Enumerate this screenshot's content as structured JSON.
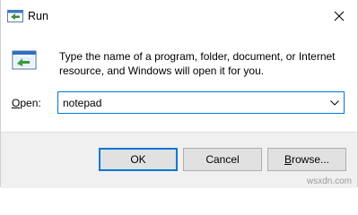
{
  "window": {
    "title": "Run",
    "close_icon": "close-icon",
    "title_icon": "run-icon"
  },
  "dialog": {
    "description": "Type the name of a program, folder, document, or Internet resource, and Windows will open it for you.",
    "open_label_mnemonic": "O",
    "open_label_rest": "pen:",
    "open_value": "notepad"
  },
  "buttons": {
    "ok": "OK",
    "cancel": "Cancel",
    "browse_mnemonic": "B",
    "browse_rest": "rowse..."
  },
  "watermark": "wsxdn.com",
  "colors": {
    "accent": "#0078d7",
    "footer_bg": "#f0f0f0",
    "button_bg": "#e1e1e1"
  }
}
